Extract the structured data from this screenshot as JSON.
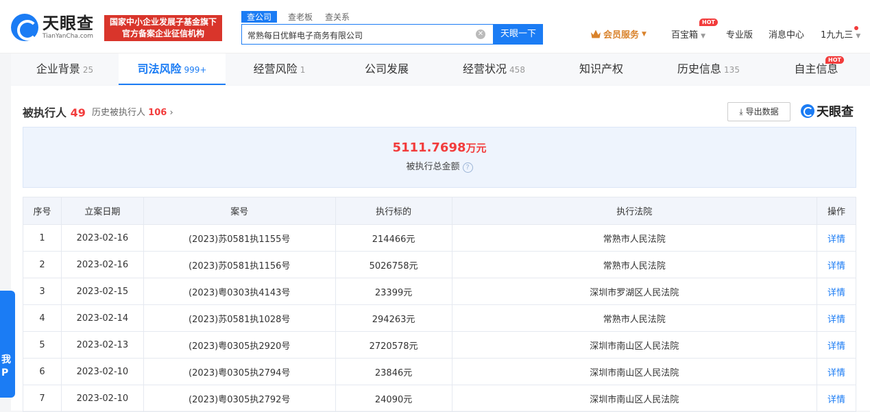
{
  "header": {
    "logo_cn": "天眼查",
    "logo_en": "TianYanCha.com",
    "banner_line1": "国家中小企业发展子基金旗下",
    "banner_line2": "官方备案企业征信机构",
    "search_tabs": [
      "查公司",
      "查老板",
      "查关系"
    ],
    "search_value": "常熟每日优鲜电子商务有限公司",
    "search_button": "天眼一下",
    "vip": "会员服务",
    "treasure": "百宝箱",
    "hot_label": "HOT",
    "pro": "专业版",
    "messages": "消息中心",
    "user": "1九九三"
  },
  "tabs": [
    {
      "label": "企业背景",
      "count": "25"
    },
    {
      "label": "司法风险",
      "count": "999+"
    },
    {
      "label": "经营风险",
      "count": "1"
    },
    {
      "label": "公司发展",
      "count": ""
    },
    {
      "label": "经营状况",
      "count": "458"
    },
    {
      "label": "知识产权",
      "count": ""
    },
    {
      "label": "历史信息",
      "count": "135"
    },
    {
      "label": "自主信息",
      "count": ""
    }
  ],
  "section": {
    "title": "被执行人",
    "count": "49",
    "history_label": "历史被执行人",
    "history_count": "106",
    "export": "导出数据",
    "brand": "天眼查",
    "total_amount": "5111.7698",
    "total_unit": "万元",
    "total_label": "被执行总金额"
  },
  "table": {
    "headers": [
      "序号",
      "立案日期",
      "案号",
      "执行标的",
      "执行法院",
      "操作"
    ],
    "rows": [
      [
        "1",
        "2023-02-16",
        "(2023)苏0581执1155号",
        "214466元",
        "常熟市人民法院",
        "详情"
      ],
      [
        "2",
        "2023-02-16",
        "(2023)苏0581执1156号",
        "5026758元",
        "常熟市人民法院",
        "详情"
      ],
      [
        "3",
        "2023-02-15",
        "(2023)粤0303执4143号",
        "23399元",
        "深圳市罗湖区人民法院",
        "详情"
      ],
      [
        "4",
        "2023-02-14",
        "(2023)苏0581执1028号",
        "294263元",
        "常熟市人民法院",
        "详情"
      ],
      [
        "5",
        "2023-02-13",
        "(2023)粤0305执2920号",
        "2720578元",
        "深圳市南山区人民法院",
        "详情"
      ],
      [
        "6",
        "2023-02-10",
        "(2023)粤0305执2794号",
        "23846元",
        "深圳市南山区人民法院",
        "详情"
      ],
      [
        "7",
        "2023-02-10",
        "(2023)粤0305执2792号",
        "24090元",
        "深圳市南山区人民法院",
        "详情"
      ]
    ]
  },
  "float_widget": {
    "line1": "我",
    "line2": "P"
  }
}
